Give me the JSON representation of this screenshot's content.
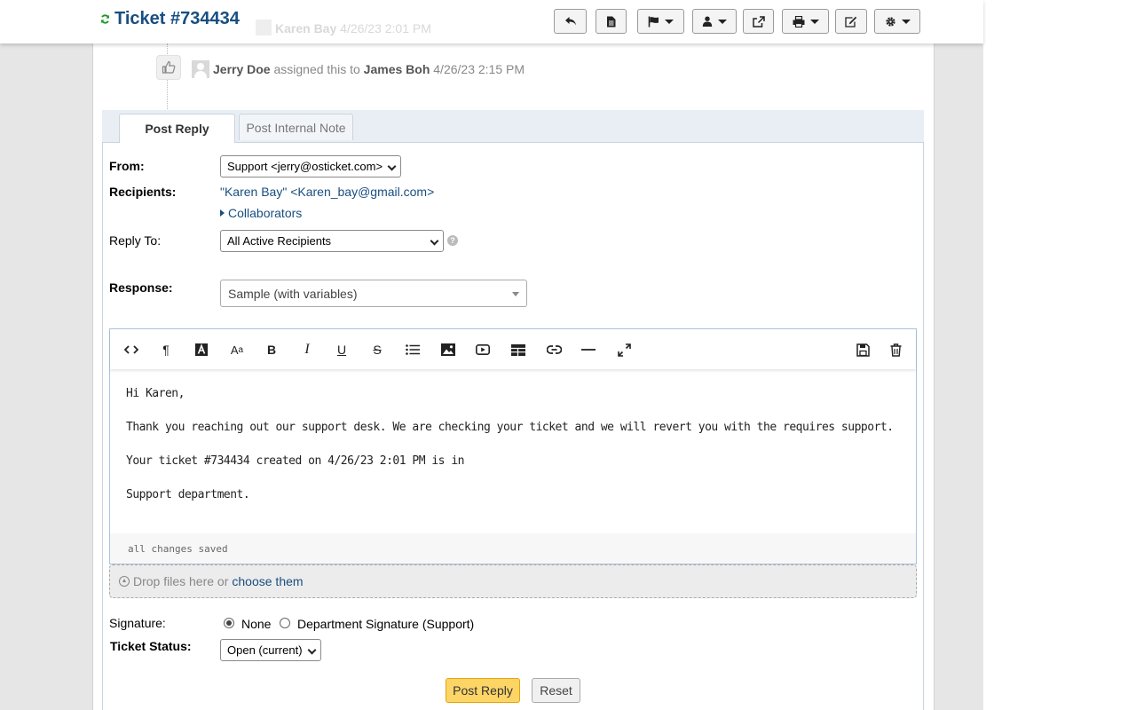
{
  "header": {
    "title": "Ticket #734434",
    "ghost_name": "Karen Bay",
    "ghost_date": "4/26/23 2:01 PM"
  },
  "thread_event": {
    "actor": "Jerry Doe",
    "action": "assigned this to",
    "target": "James Boh",
    "timestamp": "4/26/23 2:15 PM"
  },
  "tabs": {
    "post_reply": "Post Reply",
    "post_internal_note": "Post Internal Note"
  },
  "form": {
    "from_label": "From:",
    "from_value": "Support <jerry@osticket.com>",
    "recipients_label": "Recipients:",
    "recipients_value": "\"Karen Bay\" <Karen_bay@gmail.com>",
    "collaborators": "Collaborators",
    "reply_to_label": "Reply To:",
    "reply_to_value": "All Active Recipients",
    "response_label": "Response:",
    "response_value": "Sample (with variables)"
  },
  "editor": {
    "paragraphs": [
      "Hi Karen,",
      "Thank you reaching out our support desk. We are checking your ticket and we will revert you with the requires support.",
      "Your ticket #734434 created on 4/26/23 2:01 PM is in",
      "Support department."
    ],
    "status": "all changes saved"
  },
  "dropzone": {
    "text": "Drop files here or",
    "link": "choose them"
  },
  "signature": {
    "label": "Signature:",
    "option_none": "None",
    "option_department": "Department Signature (Support)",
    "selected": "None"
  },
  "status": {
    "label": "Ticket Status:",
    "value": "Open (current)"
  },
  "actions": {
    "post_reply": "Post Reply",
    "reset": "Reset"
  },
  "colors": {
    "title": "#184e81",
    "primary_button": "#fdd567",
    "refresh_icon": "#1a9a2a"
  }
}
